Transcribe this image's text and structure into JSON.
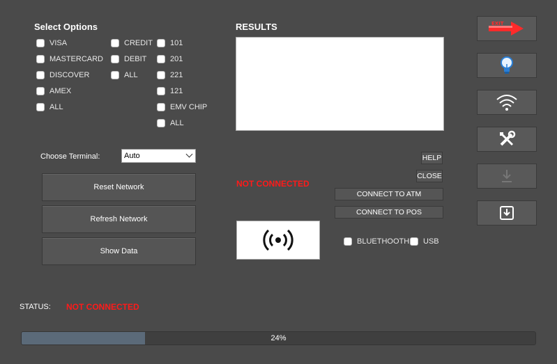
{
  "select_options": {
    "heading": "Select Options",
    "col1": [
      "VISA",
      "MASTERCARD",
      "DISCOVER",
      "AMEX",
      "ALL"
    ],
    "col2": [
      "CREDIT",
      "DEBIT",
      "ALL"
    ],
    "col3": [
      "101",
      "201",
      "221",
      "121",
      "EMV CHIP",
      "ALL"
    ]
  },
  "terminal": {
    "label": "Choose Terminal:",
    "value": "Auto"
  },
  "buttons": {
    "reset": "Reset Network",
    "refresh": "Refresh Network",
    "show": "Show Data"
  },
  "results": {
    "heading": "RESULTS"
  },
  "connection": {
    "message": "NOT CONNECTED",
    "help": "HELP",
    "close": "CLOSE",
    "atm": "CONNECT TO ATM",
    "pos": "CONNECT TO POS",
    "bluetooth": "BLUETHOOTH",
    "usb": "USB"
  },
  "status": {
    "label": "STATUS:",
    "value": "NOT CONNECTED"
  },
  "progress": {
    "value": 0.24,
    "label": "24%"
  },
  "side_icons": {
    "exit_text": "EXIT",
    "icons": [
      "exit-icon",
      "lightbulb-icon",
      "wifi-icon",
      "tools-icon",
      "download-icon",
      "import-icon"
    ]
  },
  "colors": {
    "background": "#4a4a4a",
    "alert": "#ff1a1a",
    "progress_fill": "#5b6a79"
  }
}
